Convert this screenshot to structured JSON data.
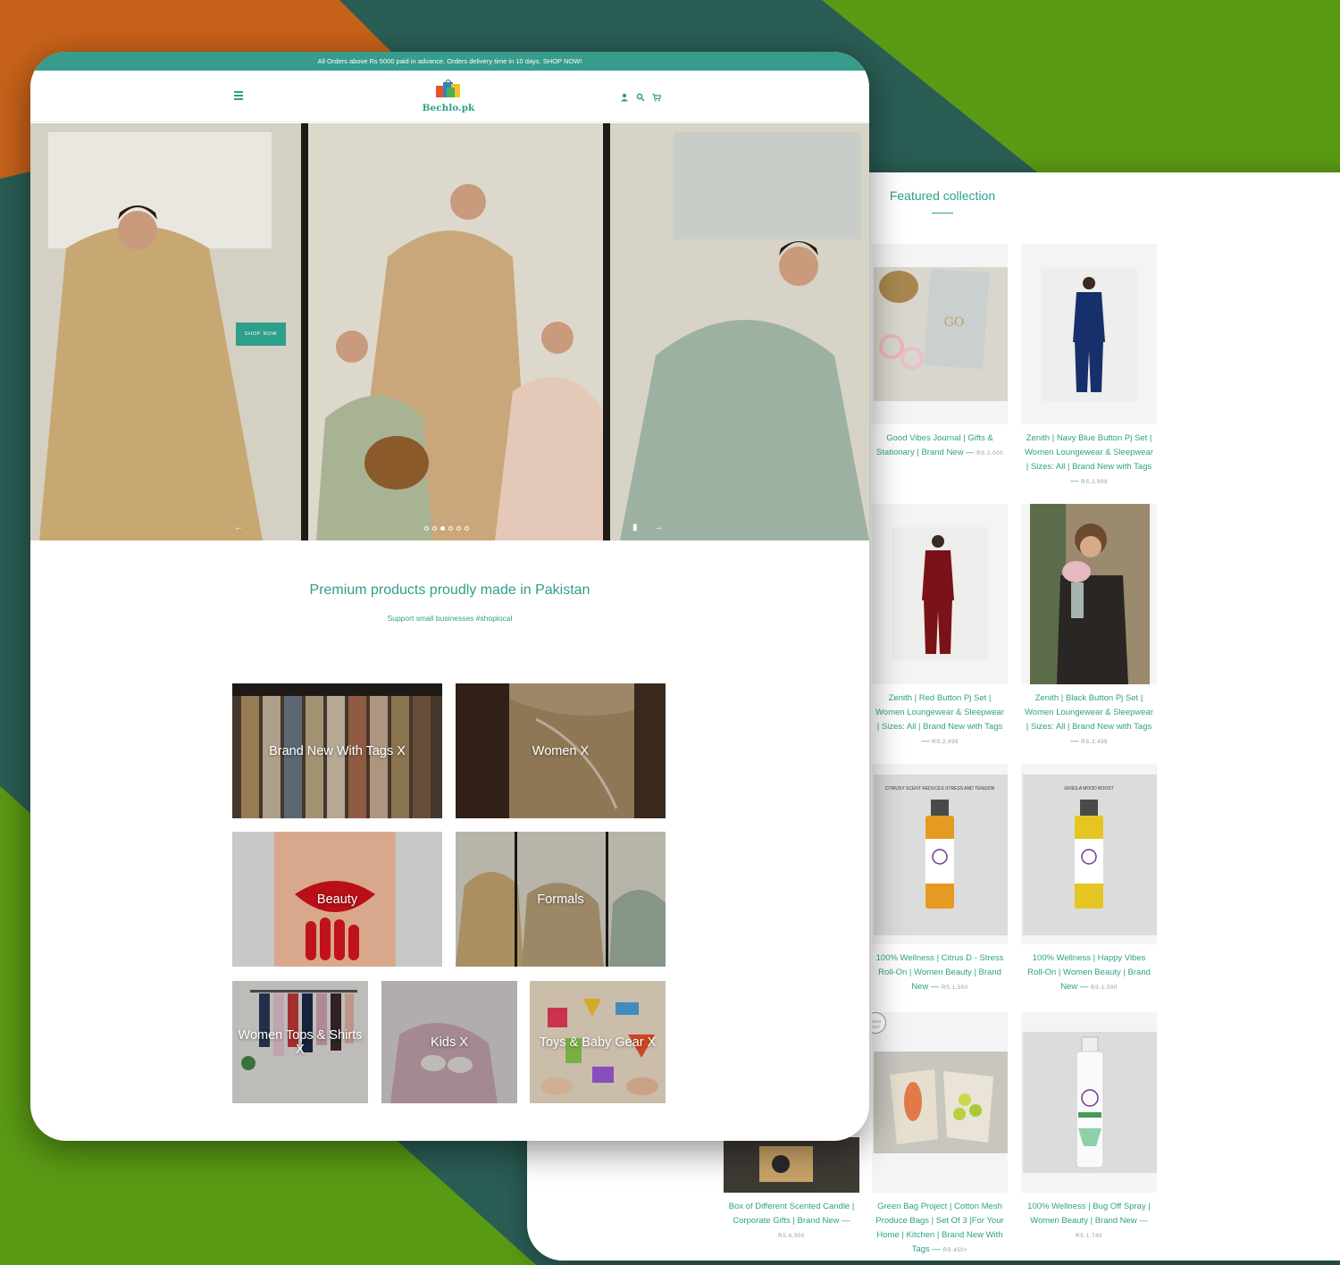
{
  "announcement": "All Orders above Rs 5000 paid in advance. Orders delivery time in 10 days. SHOP NOW!",
  "brand": {
    "name": "Bechlo.pk"
  },
  "header_icons": [
    "user-icon",
    "search-icon",
    "cart-icon"
  ],
  "hero": {
    "cta": "SHOP NOW",
    "slide_count": 6,
    "active_slide": 3
  },
  "tagline": "Premium products proudly made in Pakistan",
  "subtagline": "Support small businesses #shoplocal",
  "collections": [
    {
      "label": "Brand New With Tags X"
    },
    {
      "label": "Women X"
    },
    {
      "label": "Beauty"
    },
    {
      "label": "Formals"
    },
    {
      "label": "Women Tops & Shirts X"
    },
    {
      "label": "Kids X"
    },
    {
      "label": "Toys & Baby Gear X"
    }
  ],
  "featured": {
    "title": "Featured collection",
    "products": [
      {
        "name": "Good Vibes Journal | Gifts & Stationary | Brand New",
        "price": "RS.2,000"
      },
      {
        "name": "Zenith | Navy Blue Button Pj Set | Women Loungewear & Sleepwear | Sizes: All | Brand New with Tags",
        "price": "RS.2,999"
      },
      {
        "name": "Zenith | Red Button Pj Set | Women Loungewear & Sleepwear | Sizes: All | Brand New with Tags",
        "price": "RS.2,999"
      },
      {
        "name": "Zenith | Black Button Pj Set | Women Loungewear & Sleepwear | Sizes: All | Brand New with Tags",
        "price": "RS.2,499"
      },
      {
        "name": "100% Wellness | Citrus D - Stress Roll-On | Women Beauty | Brand New",
        "price": "RS.1,590",
        "image_text": "CITRUSY SCENT REDUCES STRESS AND TENSION"
      },
      {
        "name": "100% Wellness | Happy Vibes Roll-On | Women Beauty | Brand New",
        "price": "RS.1,590",
        "image_text": "GIVES A MOOD BOOST"
      },
      {
        "name": "Box of Different Scented Candle | Corporate Gifts | Brand New",
        "price": "RS.6,500"
      },
      {
        "name": "Green Bag Project | Cotton Mesh Produce Bags | Set Of 3 |For Your Home | Kitchen | Brand New With Tags",
        "price": "RS.450+",
        "badge": "SOLD OUT"
      },
      {
        "name": "100% Wellness | Bug Off Spray | Women Beauty | Brand New",
        "price": "RS.1,740"
      }
    ]
  },
  "colors": {
    "accent": "#2e9f8a",
    "announce_bg": "#379c8c",
    "bg_green": "#5a9a14",
    "bg_teal": "#2a5e55",
    "bg_orange": "#c7621a"
  }
}
